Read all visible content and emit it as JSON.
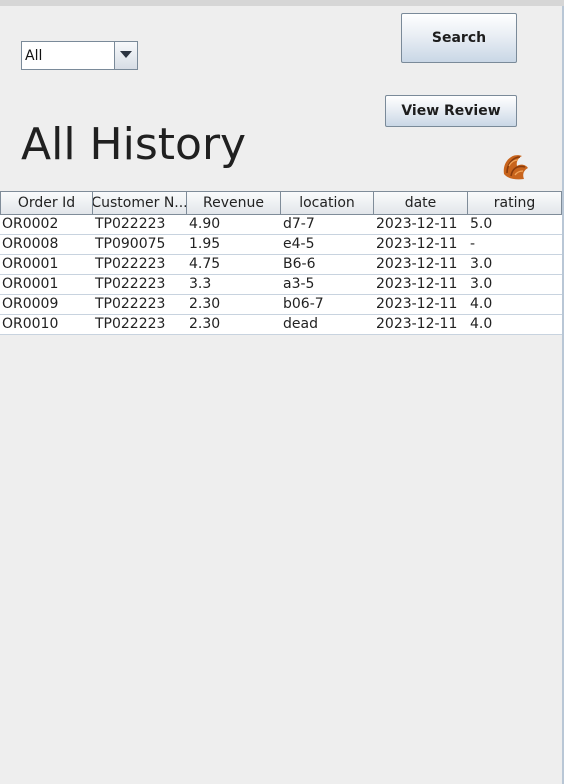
{
  "filter": {
    "selected": "All"
  },
  "buttons": {
    "search_label": "Search",
    "view_review_label": "View Review"
  },
  "page": {
    "title": "All History",
    "logo_icon": "croissant-icon"
  },
  "table": {
    "columns": [
      "Order Id",
      "Customer N...",
      "Revenue",
      "location",
      "date",
      "rating"
    ],
    "rows": [
      [
        "OR0002",
        "TP022223",
        "4.90",
        "d7-7",
        "2023-12-11",
        "5.0"
      ],
      [
        "OR0008",
        "TP090075",
        "1.95",
        "e4-5",
        "2023-12-11",
        "-"
      ],
      [
        "OR0001",
        "TP022223",
        "4.75",
        "B6-6",
        "2023-12-11",
        "3.0"
      ],
      [
        "OR0001",
        "TP022223",
        "3.3",
        "a3-5",
        "2023-12-11",
        "3.0"
      ],
      [
        "OR0009",
        "TP022223",
        "2.30",
        "b06-7",
        "2023-12-11",
        "4.0"
      ],
      [
        "OR0010",
        "TP022223",
        "2.30",
        "dead",
        "2023-12-11",
        "4.0"
      ]
    ]
  }
}
